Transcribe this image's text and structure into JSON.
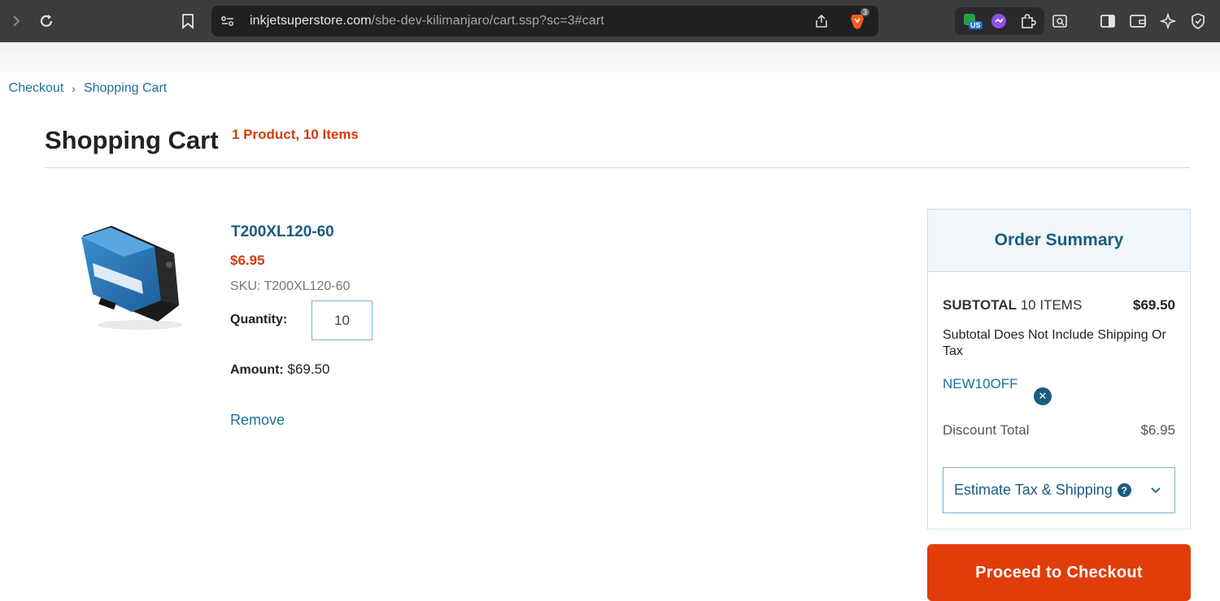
{
  "browser": {
    "url_host": "inkjetsuperstore.com",
    "url_path": "/sbe-dev-kilimanjaro/cart.ssp?sc=3#cart",
    "brave_badge": "3",
    "vpn_badge": "US",
    "icons": [
      "forward-icon",
      "reload-icon",
      "bookmark-icon",
      "site-info-icon",
      "share-icon",
      "brave-shield-icon",
      "vpn-icon",
      "extension-icon",
      "puzzle-icon",
      "screenshot-icon",
      "sidebar-icon",
      "wallet-icon",
      "leo-ai-icon",
      "shield-icon"
    ]
  },
  "breadcrumb": {
    "items": [
      "Checkout",
      "Shopping Cart"
    ]
  },
  "cart": {
    "title": "Shopping Cart",
    "count": "1 Product, 10 Items"
  },
  "item": {
    "name": "T200XL120-60",
    "price": "$6.95",
    "sku": "SKU: T200XL120-60",
    "quantity_label": "Quantity:",
    "quantity": "10",
    "amount_label": "Amount:",
    "amount": "$69.50",
    "remove_label": "Remove"
  },
  "summary": {
    "title": "Order Summary",
    "subtotal_label": "SUBTOTAL",
    "subtotal_items": "10 ITEMS",
    "subtotal_value": "$69.50",
    "note": "Subtotal Does Not Include Shipping Or Tax",
    "promo_code": "NEW10OFF",
    "discount_label": "Discount Total",
    "discount_value": "$6.95",
    "estimate_label": "Estimate Tax & Shipping",
    "checkout_label": "Proceed to Checkout"
  },
  "colors": {
    "accent_orange": "#e03d0b",
    "link_blue": "#1f6f99",
    "heading_blue": "#1a5d80"
  }
}
